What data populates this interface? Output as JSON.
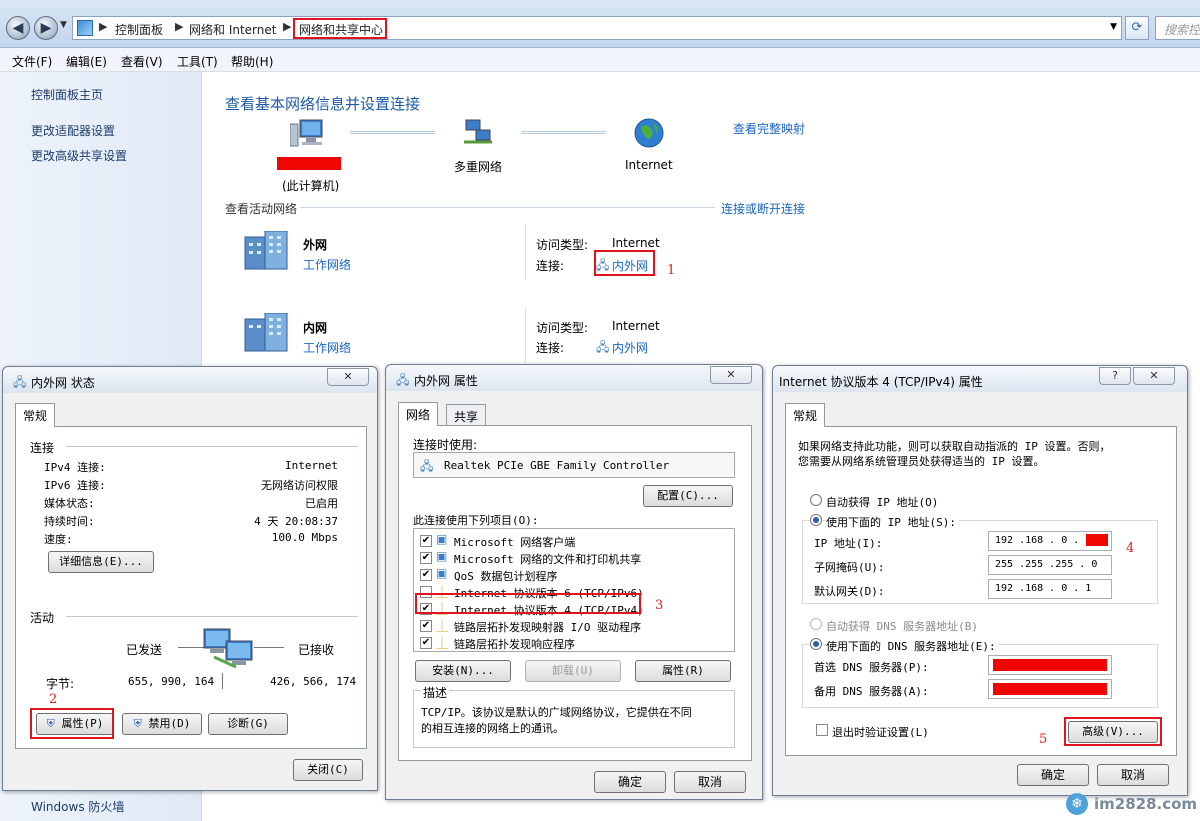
{
  "breadcrumb": {
    "items": [
      "控制面板",
      "网络和 Internet",
      "网络和共享中心"
    ],
    "search_placeholder": "搜索控制面板"
  },
  "menu": [
    "文件(F)",
    "编辑(E)",
    "查看(V)",
    "工具(T)",
    "帮助(H)"
  ],
  "sidebar": {
    "items": [
      "控制面板主页",
      "更改适配器设置",
      "更改高级共享设置"
    ],
    "bottom": "Windows 防火墙"
  },
  "main": {
    "title": "查看基本网络信息并设置连接",
    "view_full_map": "查看完整映射",
    "map": {
      "this_pc": "(此计算机)",
      "multi": "多重网络",
      "internet": "Internet"
    },
    "active_networks_label": "查看活动网络",
    "connect_link": "连接或断开连接",
    "networks": [
      {
        "name": "外网",
        "type": "工作网络",
        "access_label": "访问类型:",
        "access": "Internet",
        "conn_label": "连接:",
        "conn": "内外网"
      },
      {
        "name": "内网",
        "type": "工作网络",
        "access_label": "访问类型:",
        "access": "Internet",
        "conn_label": "连接:",
        "conn": "内外网"
      }
    ]
  },
  "annotations": [
    "1",
    "2",
    "3",
    "4",
    "5"
  ],
  "status_dialog": {
    "title": "内外网 状态",
    "tab": "常规",
    "connection_header": "连接",
    "rows": [
      {
        "label": "IPv4 连接:",
        "value": "Internet"
      },
      {
        "label": "IPv6 连接:",
        "value": "无网络访问权限"
      },
      {
        "label": "媒体状态:",
        "value": "已启用"
      },
      {
        "label": "持续时间:",
        "value": "4 天 20:08:37"
      },
      {
        "label": "速度:",
        "value": "100.0 Mbps"
      }
    ],
    "details_btn": "详细信息(E)...",
    "activity_header": "活动",
    "sent": "已发送",
    "received": "已接收",
    "bytes_label": "字节:",
    "bytes_sent": "655, 990, 164",
    "bytes_received": "426, 566, 174",
    "props_btn": "属性(P)",
    "disable_btn": "禁用(D)",
    "diagnose_btn": "诊断(G)",
    "close_btn": "关闭(C)"
  },
  "props_dialog": {
    "title": "内外网 属性",
    "tabs": [
      "网络",
      "共享"
    ],
    "connect_using": "连接时使用:",
    "adapter": "Realtek PCIe GBE Family Controller",
    "configure_btn": "配置(C)...",
    "items_label": "此连接使用下列项目(O):",
    "items": [
      {
        "text": "Microsoft 网络客户端",
        "checked": "✔"
      },
      {
        "text": "Microsoft 网络的文件和打印机共享",
        "checked": "✔"
      },
      {
        "text": "QoS 数据包计划程序",
        "checked": "✔"
      },
      {
        "text": "Internet 协议版本 6 (TCP/IPv6)",
        "checked": ""
      },
      {
        "text": "Internet 协议版本 4 (TCP/IPv4)",
        "checked": "✔"
      },
      {
        "text": "链路层拓扑发现映射器 I/O 驱动程序",
        "checked": "✔"
      },
      {
        "text": "链路层拓扑发现响应程序",
        "checked": "✔"
      }
    ],
    "install_btn": "安装(N)...",
    "uninstall_btn": "卸载(U)",
    "properties_btn": "属性(R)",
    "desc_label": "描述",
    "desc_text_1": "TCP/IP。该协议是默认的广域网络协议，它提供在不同",
    "desc_text_2": "的相互连接的网络上的通讯。",
    "ok_btn": "确定",
    "cancel_btn": "取消"
  },
  "ipv4_dialog": {
    "title": "Internet 协议版本 4 (TCP/IPv4) 属性",
    "help": "?",
    "tab": "常规",
    "intro_1": "如果网络支持此功能，则可以获取自动指派的 IP 设置。否则，",
    "intro_2": "您需要从网络系统管理员处获得适当的 IP 设置。",
    "auto_ip": "自动获得 IP 地址(O)",
    "manual_ip": "使用下面的 IP 地址(S):",
    "ip_label": "IP 地址(I):",
    "ip_value": "192 .168 . 0 .",
    "mask_label": "子网掩码(U):",
    "mask_value": "255 .255 .255 . 0",
    "gw_label": "默认网关(D):",
    "gw_value": "192 .168 . 0 . 1",
    "auto_dns": "自动获得 DNS 服务器地址(B)",
    "manual_dns": "使用下面的 DNS 服务器地址(E):",
    "pref_dns": "首选 DNS 服务器(P):",
    "alt_dns": "备用 DNS 服务器(A):",
    "validate": "退出时验证设置(L)",
    "advanced_btn": "高级(V)...",
    "ok_btn": "确定",
    "cancel_btn": "取消"
  },
  "watermark": "im2828.com"
}
